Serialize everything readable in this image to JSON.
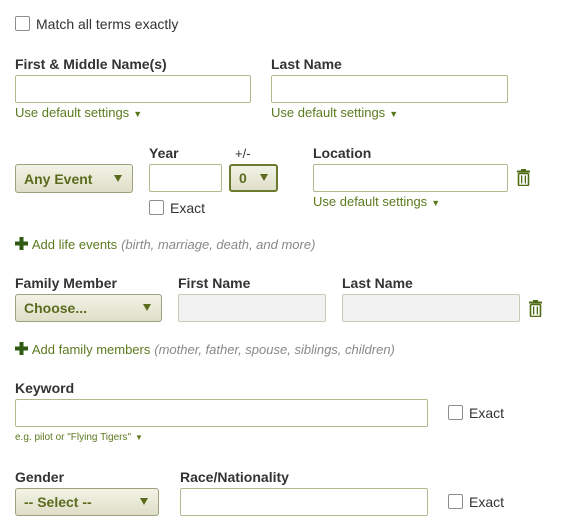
{
  "match_exact": {
    "label": "Match all terms exactly"
  },
  "first_middle": {
    "label": "First & Middle Name(s)",
    "value": "",
    "settings": "Use default settings"
  },
  "last_name": {
    "label": "Last Name",
    "value": "",
    "settings": "Use default settings"
  },
  "event": {
    "type_selected": "Any Event",
    "year_label": "Year",
    "year_value": "",
    "range_label": "+/-",
    "range_selected": "0",
    "exact_label": "Exact",
    "location_label": "Location",
    "location_value": "",
    "location_settings": "Use default settings"
  },
  "add_life_events": {
    "label": "Add life events",
    "hint": "(birth, marriage, death, and more)"
  },
  "family": {
    "member_label": "Family Member",
    "member_selected": "Choose...",
    "first_label": "First Name",
    "last_label": "Last Name"
  },
  "add_family": {
    "label": "Add family members",
    "hint": "(mother, father, spouse, siblings, children)"
  },
  "keyword": {
    "label": "Keyword",
    "value": "",
    "exact_label": "Exact",
    "example": "e.g. pilot or \"Flying Tigers\""
  },
  "gender": {
    "label": "Gender",
    "selected": "-- Select --"
  },
  "race": {
    "label": "Race/Nationality",
    "value": "",
    "exact_label": "Exact"
  },
  "colors": {
    "accent": "#5b7a1e",
    "icon": "#4e6b14",
    "border": "#b7b78f"
  }
}
